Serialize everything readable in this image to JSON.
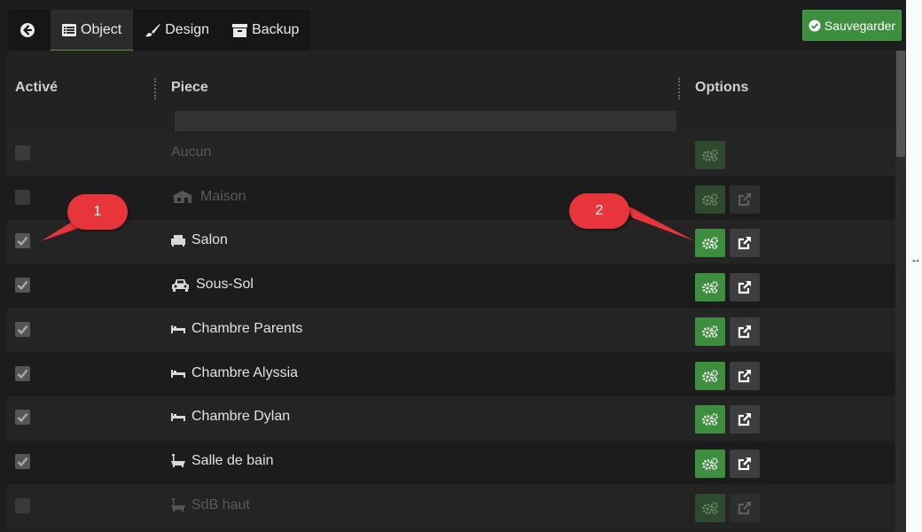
{
  "tabs": {
    "back_icon": "arrow-circle-left-icon",
    "object": {
      "label": "Object",
      "icon": "list-icon"
    },
    "design": {
      "label": "Design",
      "icon": "brush-icon"
    },
    "backup": {
      "label": "Backup",
      "icon": "archive-icon"
    }
  },
  "save_button": {
    "label": "Sauvegarder",
    "icon": "check-circle-icon",
    "color": "#3e8e3f"
  },
  "table": {
    "headers": {
      "active": "Activé",
      "piece": "Piece",
      "options": "Options"
    },
    "filter_placeholder": "",
    "rows": [
      {
        "name": "Aucun",
        "icon": "",
        "checked": false,
        "enabled": false,
        "has_link": false
      },
      {
        "name": "Maison",
        "icon": "house-icon",
        "checked": false,
        "enabled": false,
        "has_link": true
      },
      {
        "name": "Salon",
        "icon": "sofa-icon",
        "checked": true,
        "enabled": true,
        "has_link": true
      },
      {
        "name": "Sous-Sol",
        "icon": "car-icon",
        "checked": true,
        "enabled": true,
        "has_link": true
      },
      {
        "name": "Chambre Parents",
        "icon": "bed-icon",
        "checked": true,
        "enabled": true,
        "has_link": true
      },
      {
        "name": "Chambre Alyssia",
        "icon": "bed-icon",
        "checked": true,
        "enabled": true,
        "has_link": true
      },
      {
        "name": "Chambre Dylan",
        "icon": "bed-icon",
        "checked": true,
        "enabled": true,
        "has_link": true
      },
      {
        "name": "Salle de bain",
        "icon": "bathtub-icon",
        "checked": true,
        "enabled": true,
        "has_link": true
      },
      {
        "name": "SdB haut",
        "icon": "bathtub-icon",
        "checked": false,
        "enabled": false,
        "has_link": true
      }
    ]
  },
  "callouts": {
    "one": "1",
    "two": "2",
    "color": "#e8353b"
  }
}
